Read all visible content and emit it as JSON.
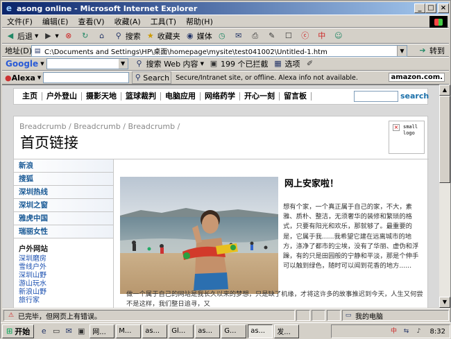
{
  "window": {
    "title": "asong online - Microsoft Internet Explorer",
    "min": "_",
    "max": "□",
    "close": "×"
  },
  "menu": [
    "文件(F)",
    "编辑(E)",
    "查看(V)",
    "收藏(A)",
    "工具(T)",
    "帮助(H)"
  ],
  "toolbar": {
    "back": "后退",
    "search": "搜索",
    "favorites": "收藏夹",
    "media": "媒体"
  },
  "address": {
    "label": "地址(D)",
    "url": "C:\\Documents and Settings\\HP\\桌面\\homepage\\mysite\\test041002\\Untitled-1.htm",
    "go": "转到"
  },
  "google": {
    "label": "Google",
    "search_web": "搜索 Web 内容",
    "blocked": "199 个已拦截",
    "options": "选项"
  },
  "alexa": {
    "label": "Alexa",
    "search": "Search",
    "info": "Secure/Intranet site, or offline. Alexa info not available.",
    "amazon": "amazon.com."
  },
  "nav": {
    "items": [
      "主页",
      "户外登山",
      "摄影天地",
      "篮球裁判",
      "电脑应用",
      "网络药学",
      "开心一刻",
      "留言板"
    ],
    "search_button": "search"
  },
  "page": {
    "breadcrumb": "Breadcrumb / Breadcrumb / Breadcrumb /",
    "heading": "首页链接",
    "logo_text": "small logo"
  },
  "sidebar": {
    "items": [
      "新浪",
      "搜狐",
      "深圳热线",
      "深圳之窗",
      "雅虎中国",
      "瑞丽女性"
    ],
    "section_title": "户外网站",
    "links": [
      "深圳磨房",
      "雪线户外",
      "深圳山野",
      "游山玩水",
      "新浪山野",
      "旅行家"
    ]
  },
  "article": {
    "title": "网上安家啦！",
    "body1": "想有个家，一个真正属于自己的家，不大，素雅、质朴、整洁，无须奢华的装修和繁琐的格式，只要有阳光和欢乐，那就够了。最重要的是，它属于我......我希望它建在远离城市的地方，涤净了都市的尘埃，没有了华丽、虚伪和浮躁，有的只是田园般的宁静和平淡，那是个伸手可以触到绿色，随时可以闻到花香的地方......",
    "body2": "做一个属于自己的网站是我长久以来的梦想，只是缺了机缘，才将这许多的故事推迟到今天，人生又何尝不是这样，我们整日追寻，又"
  },
  "status": {
    "text": "已完毕，但网页上有错误。",
    "zone": "我的电脑"
  },
  "taskbar": {
    "start": "开始",
    "items": [
      "网...",
      "M...",
      "as...",
      "Gl...",
      "as...",
      "G...",
      "as...",
      "发..."
    ],
    "clock": "8:32"
  }
}
